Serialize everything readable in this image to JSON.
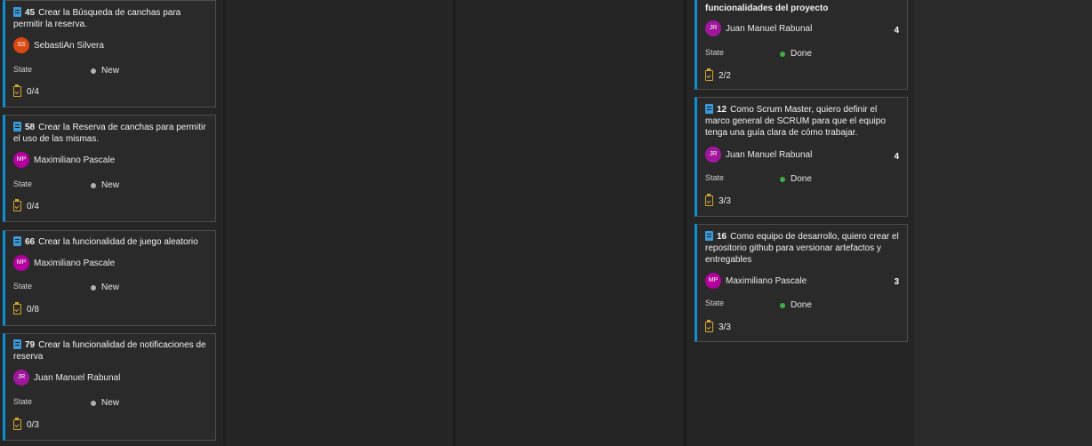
{
  "colors": {
    "new_dot": "#b0b0b0",
    "done_dot": "#3eab48",
    "card_accent": "#0e8fd1",
    "task_icon": "#d4a72c"
  },
  "left_column": {
    "cards": [
      {
        "id": "45",
        "title": "Crear la Búsqueda de canchas para permitir la reserva.",
        "assignee": "SebastiAn Silvera",
        "initials": "SS",
        "avatar_color": "#d9480f",
        "state_label": "State",
        "state": "New",
        "tasks": "0/4",
        "icon": "backlog-item-icon"
      },
      {
        "id": "58",
        "title": "Crear la Reserva de canchas para permitir el uso de las mismas.",
        "assignee": "Maximiliano Pascale",
        "initials": "MP",
        "avatar_color": "#b4009e",
        "state_label": "State",
        "state": "New",
        "tasks": "0/4",
        "icon": "backlog-item-icon"
      },
      {
        "id": "66",
        "title": "Crear la funcionalidad de juego aleatorio",
        "assignee": "Maximiliano Pascale",
        "initials": "MP",
        "avatar_color": "#b4009e",
        "state_label": "State",
        "state": "New",
        "tasks": "0/8",
        "icon": "backlog-item-icon"
      },
      {
        "id": "79",
        "title": "Crear la funcionalidad de notificaciones de reserva",
        "assignee": "Juan Manuel Rabunal",
        "initials": "JR",
        "avatar_color": "#a0179e",
        "state_label": "State",
        "state": "New",
        "tasks": "0/3",
        "icon": "backlog-item-icon"
      }
    ]
  },
  "done_column": {
    "partial_card": {
      "title_tail": "funcionalidades del proyecto",
      "assignee": "Juan Manuel Rabunal",
      "initials": "JR",
      "avatar_color": "#a0179e",
      "effort": "4",
      "state_label": "State",
      "state": "Done",
      "tasks": "2/2"
    },
    "cards": [
      {
        "id": "12",
        "title": "Como Scrum Master, quiero definir el marco general de SCRUM para que el equipo tenga una guía clara de cómo trabajar.",
        "assignee": "Juan Manuel Rabunal",
        "initials": "JR",
        "avatar_color": "#a0179e",
        "effort": "4",
        "state_label": "State",
        "state": "Done",
        "tasks": "3/3",
        "icon": "backlog-item-icon"
      },
      {
        "id": "16",
        "title": "Como equipo de desarrollo, quiero crear el repositorio github para versionar artefactos y entregables",
        "assignee": "Maximiliano Pascale",
        "initials": "MP",
        "avatar_color": "#b4009e",
        "effort": "3",
        "state_label": "State",
        "state": "Done",
        "tasks": "3/3",
        "icon": "backlog-item-icon"
      }
    ]
  }
}
